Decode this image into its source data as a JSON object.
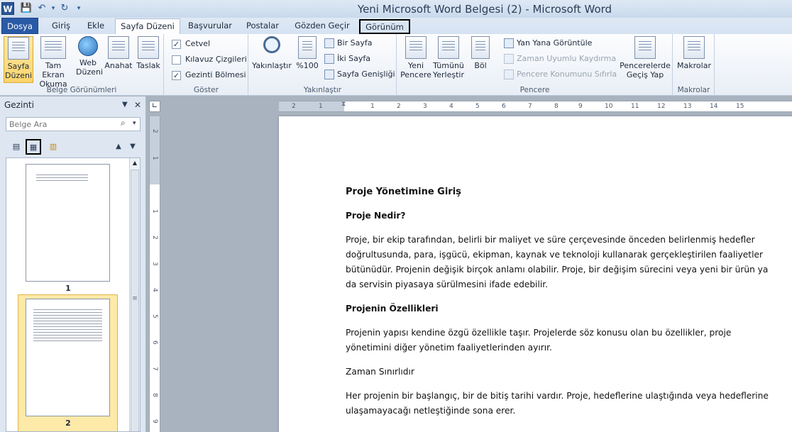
{
  "window": {
    "title": "Yeni Microsoft Word Belgesi (2)  -  Microsoft Word",
    "app_icon_letter": "W"
  },
  "tabs": [
    {
      "label": "Dosya"
    },
    {
      "label": "Giriş"
    },
    {
      "label": "Ekle"
    },
    {
      "label": "Sayfa Düzeni"
    },
    {
      "label": "Başvurular"
    },
    {
      "label": "Postalar"
    },
    {
      "label": "Gözden Geçir"
    },
    {
      "label": "Görünüm"
    }
  ],
  "ribbon": {
    "views": {
      "label": "Belge Görünümleri",
      "buttons": [
        "Sayfa Düzeni",
        "Tam Ekran Okuma",
        "Web Düzeni",
        "Anahat",
        "Taslak"
      ]
    },
    "show": {
      "label": "Göster",
      "items": [
        {
          "label": "Cetvel",
          "checked": true
        },
        {
          "label": "Kılavuz Çizgileri",
          "checked": false
        },
        {
          "label": "Gezinti Bölmesi",
          "checked": true
        }
      ]
    },
    "zoom": {
      "label": "Yakınlaştır",
      "zoom_button": "Yakınlaştır",
      "hundred_button": "%100",
      "one_page": "Bir Sayfa",
      "two_pages": "İki Sayfa",
      "page_width": "Sayfa Genişliği"
    },
    "window": {
      "label": "Pencere",
      "new_window": "Yeni Pencere",
      "arrange_all": "Tümünü Yerleştir",
      "split": "Böl",
      "side_by_side": "Yan Yana Görüntüle",
      "sync_scroll": "Zaman Uyumlu Kaydırma",
      "reset_position": "Pencere Konumunu Sıfırla",
      "switch_windows": "Pencerelerde Geçiş Yap"
    },
    "macros": {
      "label": "Makrolar",
      "button": "Makrolar"
    }
  },
  "nav": {
    "title": "Gezinti",
    "search_placeholder": "Belge Ara",
    "page_numbers": [
      "1",
      "2"
    ]
  },
  "ruler": {
    "h_ticks": [
      "2",
      "1",
      "1",
      "2",
      "3",
      "4",
      "5",
      "6",
      "7",
      "8",
      "9",
      "10",
      "11",
      "12",
      "13",
      "14",
      "15"
    ],
    "v_ticks": [
      "2",
      "1",
      "1",
      "2",
      "3",
      "4",
      "5",
      "6",
      "7",
      "8",
      "9"
    ]
  },
  "document": {
    "title": "Proje Yönetimine Giriş",
    "h_what": "Proje Nedir?",
    "p_what": "Proje, bir ekip tarafından, belirli bir maliyet ve süre çerçevesinde önceden belirlenmiş hedefler doğrultusunda, para, işgücü, ekipman, kaynak ve teknoloji kullanarak gerçekleştirilen faaliyetler bütünüdür. Projenin değişik birçok anlamı olabilir.  Proje, bir değişim sürecini veya yeni bir ürün ya da servisin piyasaya sürülmesini ifade edebilir.",
    "h_features": "Projenin Özellikleri",
    "p_features": "Projenin yapısı kendine özgü özellikle taşır. Projelerde söz konusu olan bu özellikler, proje yönetimini diğer yönetim faaliyetlerinden ayırır.",
    "h_time": "Zaman Sınırlıdır",
    "p_time": "Her projenin bir başlangıç, bir de bitiş tarihi vardır. Proje, hedeflerine ulaştığında veya hedeflerine ulaşamayacağı netleştiğinde sona erer."
  }
}
